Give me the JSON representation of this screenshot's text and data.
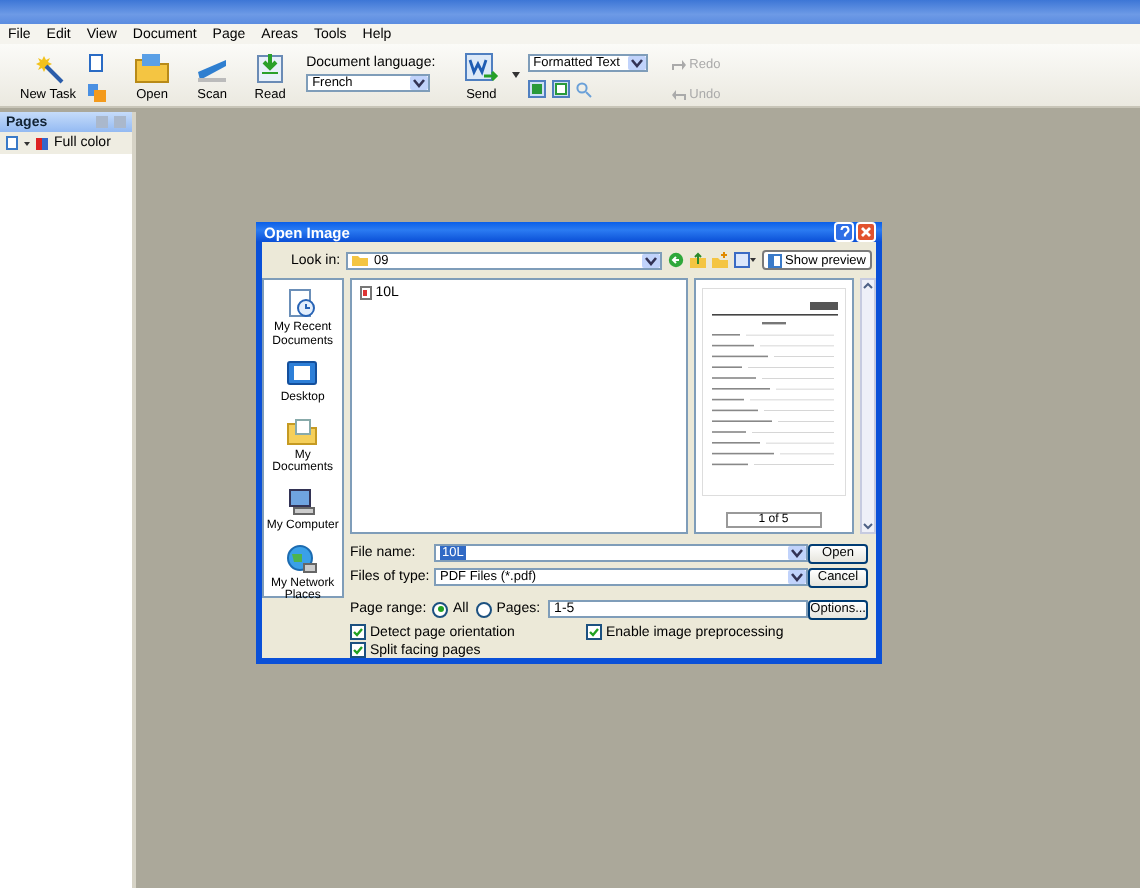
{
  "menu": [
    "File",
    "Edit",
    "View",
    "Document",
    "Page",
    "Areas",
    "Tools",
    "Help"
  ],
  "toolbar": {
    "new_task": "New Task",
    "open": "Open",
    "scan": "Scan",
    "read": "Read",
    "language_label": "Document language:",
    "language": "French",
    "send": "Send",
    "format": "Formatted Text",
    "redo": {
      "label": "Redo",
      "disabled": true
    },
    "undo": {
      "label": "Undo",
      "disabled": true
    }
  },
  "pages_panel": {
    "title": "Pages",
    "color_mode": "Full color"
  },
  "dialog": {
    "title": "Open Image",
    "look_in_label": "Look in:",
    "look_in": "09",
    "show_preview": "Show preview",
    "places": [
      {
        "label": "My Recent Documents",
        "kind": "recent"
      },
      {
        "label": "Desktop",
        "kind": "desktop"
      },
      {
        "label": "My Documents",
        "kind": "documents"
      },
      {
        "label": "My Computer",
        "kind": "computer"
      },
      {
        "label": "My Network Places",
        "kind": "network"
      }
    ],
    "files": [
      {
        "name": "10L",
        "selected": false
      }
    ],
    "preview": {
      "page_indicator": "1 of 5"
    },
    "file_name_label": "File name:",
    "file_name": "10L",
    "file_type_label": "Files of type:",
    "file_type": "PDF Files (*.pdf)",
    "page_range_label": "Page range:",
    "page_range": [
      {
        "label": "All",
        "selected": true
      },
      {
        "label": "Pages:",
        "selected": false
      }
    ],
    "pages_value": "1-5",
    "checkboxes": [
      {
        "label": "Detect page orientation",
        "checked": true
      },
      {
        "label": "Enable image preprocessing",
        "checked": true
      },
      {
        "label": "Split facing pages",
        "checked": true
      }
    ],
    "buttons": [
      "Open",
      "Cancel",
      "Options..."
    ]
  }
}
